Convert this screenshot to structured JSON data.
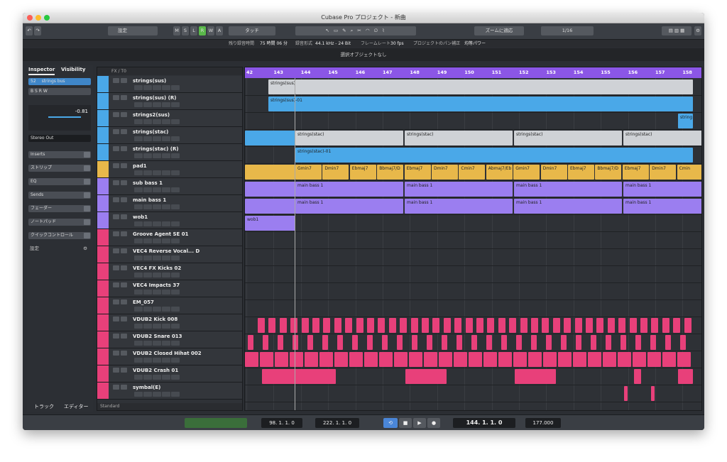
{
  "window": {
    "title": "Cubase Pro プロジェクト - 新曲"
  },
  "toolbar": {
    "preset_label": "設定",
    "mode_buttons": [
      "M",
      "S",
      "L",
      "R",
      "W",
      "A"
    ],
    "automation_mode": "タッチ",
    "zoom_label": "ズームに適応",
    "quantize": "1/16"
  },
  "info_line": {
    "remaining_label": "残り録音時間",
    "remaining_value": "75 時間 06 分",
    "format_label": "録音形式",
    "format_value": "44.1 kHz - 24 Bit",
    "frame_label": "フレームレート",
    "frame_value": "30 fps",
    "pan_label": "プロジェクトのパン補正",
    "pan_value": "均等パワー"
  },
  "selection_status": "選択オブジェクトなし",
  "inspector": {
    "tabs": [
      "Inspector",
      "Visibility"
    ],
    "track_number": "52",
    "track_name": "strings bus",
    "volume_value": "-0.81",
    "output": "Stereo Out",
    "sections": [
      "Inserts",
      "ストリップ",
      "EQ",
      "Sends",
      "フェーダー",
      "ノートパッド",
      "クイックコントロール"
    ],
    "settings_label": "設定",
    "bottom_tabs": [
      "トラック",
      "エディター"
    ]
  },
  "tracklist": {
    "header_label": "FX / T0",
    "footer_label": "Standard",
    "tracks": [
      {
        "name": "strings(sus)",
        "color": "#4aa8e8"
      },
      {
        "name": "strings(sus) (R)",
        "color": "#4aa8e8"
      },
      {
        "name": "strings2(sus)",
        "color": "#4aa8e8"
      },
      {
        "name": "strings(stac)",
        "color": "#4aa8e8"
      },
      {
        "name": "strings(stac) (R)",
        "color": "#4aa8e8"
      },
      {
        "name": "pad1",
        "color": "#e8b84a"
      },
      {
        "name": "sub bass 1",
        "color": "#9b7ef0"
      },
      {
        "name": "main bass 1",
        "color": "#9b7ef0"
      },
      {
        "name": "wob1",
        "color": "#9b7ef0"
      },
      {
        "name": "Groove Agent SE 01",
        "color": "#e8407a"
      },
      {
        "name": "VEC4 Reverse Vocal... D",
        "color": "#e8407a"
      },
      {
        "name": "VEC4 FX Kicks 02",
        "color": "#e8407a"
      },
      {
        "name": "VEC4 Impacts 37",
        "color": "#e8407a"
      },
      {
        "name": "EM_057",
        "color": "#e8407a"
      },
      {
        "name": "VDUB2 Kick 008",
        "color": "#e8407a"
      },
      {
        "name": "VDUB2 Snare 013",
        "color": "#e8407a"
      },
      {
        "name": "VDUB2 Closed Hihat 002",
        "color": "#e8407a"
      },
      {
        "name": "VDUB2 Crash 01",
        "color": "#e8407a"
      },
      {
        "name": "symbal(E)",
        "color": "#e8407a"
      }
    ]
  },
  "ruler": {
    "bars": [
      "42",
      "143",
      "144",
      "145",
      "146",
      "147",
      "148",
      "149",
      "150",
      "151",
      "152",
      "153",
      "154",
      "155",
      "156",
      "157",
      "158"
    ]
  },
  "clips": {
    "strings_sus": "strings(sus)",
    "strings_sus_r": "strings(sus)-01",
    "strings2": "string",
    "strings_stac": "strings(stac)",
    "strings_stac_r": "strings(stac)-01",
    "main_bass": "main bass 1",
    "wob": "wob1",
    "chords": [
      "Gmin7",
      "Dmin7",
      "Ebmaj7",
      "Bbmaj7/D",
      "Ebmaj7",
      "Dmin7",
      "Cmin7",
      "Abmaj7/Eb",
      "Gmin7",
      "Dmin7",
      "Ebmaj7",
      "Bbmaj7/D",
      "Ebmaj7",
      "Dmin7",
      "Cmin"
    ]
  },
  "transport": {
    "left_locator": "98. 1. 1. 0",
    "right_locator": "222. 1. 1. 0",
    "position": "144. 1. 1. 0",
    "tempo": "177.000"
  },
  "colors": {
    "ruler": "#8b56e6",
    "audio_blue": "#4aa8e8",
    "pad_yellow": "#e8b84a",
    "bass_purple": "#9b7ef0",
    "drum_pink": "#e8407a"
  }
}
